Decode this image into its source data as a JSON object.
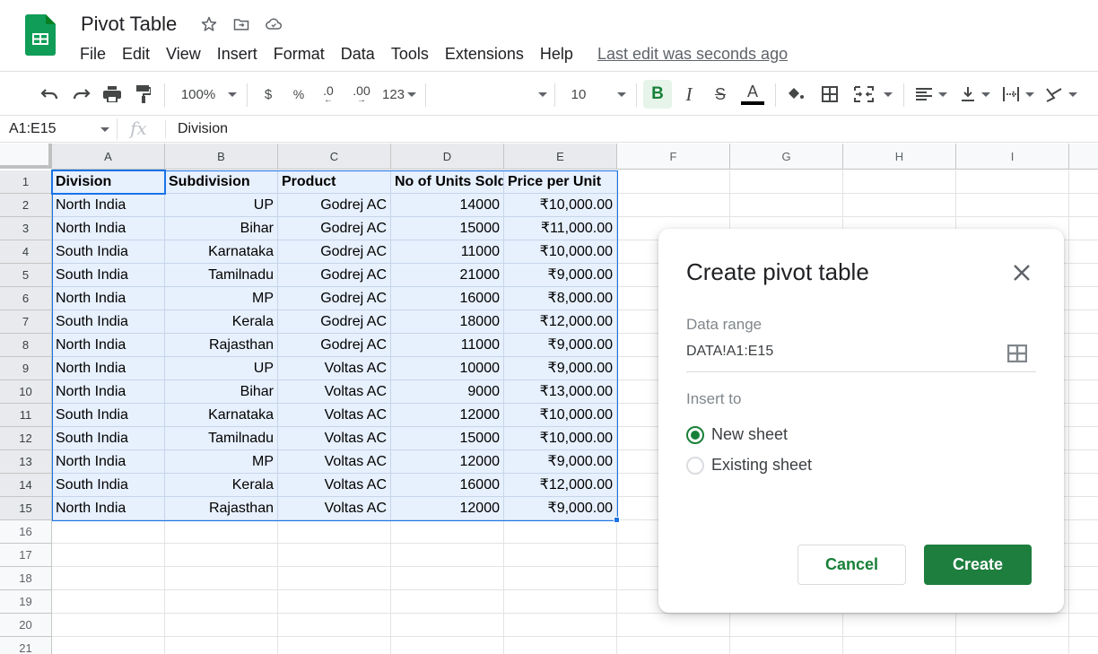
{
  "app": {
    "title": "Pivot Table",
    "brand_color": "#0f9d58",
    "menu": [
      "File",
      "Edit",
      "View",
      "Insert",
      "Format",
      "Data",
      "Tools",
      "Extensions",
      "Help"
    ],
    "last_edit": "Last edit was seconds ago",
    "title_icons": [
      "star-icon",
      "move-to-folder-icon",
      "cloud-saved-icon"
    ]
  },
  "toolbar": {
    "zoom": "100%",
    "currency": "$",
    "percent": "%",
    "decrease_decimal": ".0",
    "increase_decimal": ".00",
    "more_formats": "123",
    "font_family": "",
    "font_size": "10",
    "bold": "B",
    "italic": "I",
    "strikethrough": "S",
    "text_color": "A",
    "accent_color": "#188038"
  },
  "formula_bar": {
    "name_box": "A1:E15",
    "fx": "fx",
    "value": "Division"
  },
  "sheet": {
    "columns": [
      "A",
      "B",
      "C",
      "D",
      "E",
      "F",
      "G",
      "H",
      "I"
    ],
    "row_numbers": [
      "1",
      "2",
      "3",
      "4",
      "5",
      "6",
      "7",
      "8",
      "9",
      "10",
      "11",
      "12",
      "13",
      "14",
      "15",
      "16",
      "17",
      "18",
      "19",
      "20",
      "21"
    ],
    "headers": [
      "Division",
      "Subdivision",
      "Product",
      "No of Units Sold",
      "Price per Unit"
    ],
    "rows": [
      [
        "North India",
        "UP",
        "Godrej AC",
        "14000",
        "₹10,000.00"
      ],
      [
        "North India",
        "Bihar",
        "Godrej AC",
        "15000",
        "₹11,000.00"
      ],
      [
        "South India",
        "Karnataka",
        "Godrej AC",
        "11000",
        "₹10,000.00"
      ],
      [
        "South India",
        "Tamilnadu",
        "Godrej AC",
        "21000",
        "₹9,000.00"
      ],
      [
        "North India",
        "MP",
        "Godrej AC",
        "16000",
        "₹8,000.00"
      ],
      [
        "South India",
        "Kerala",
        "Godrej AC",
        "18000",
        "₹12,000.00"
      ],
      [
        "North India",
        "Rajasthan",
        "Godrej AC",
        "11000",
        "₹9,000.00"
      ],
      [
        "North India",
        "UP",
        "Voltas AC",
        "10000",
        "₹9,000.00"
      ],
      [
        "North India",
        "Bihar",
        "Voltas AC",
        "9000",
        "₹13,000.00"
      ],
      [
        "South India",
        "Karnataka",
        "Voltas AC",
        "12000",
        "₹10,000.00"
      ],
      [
        "South India",
        "Tamilnadu",
        "Voltas AC",
        "15000",
        "₹10,000.00"
      ],
      [
        "North India",
        "MP",
        "Voltas AC",
        "12000",
        "₹9,000.00"
      ],
      [
        "South India",
        "Kerala",
        "Voltas AC",
        "16000",
        "₹12,000.00"
      ],
      [
        "North India",
        "Rajasthan",
        "Voltas AC",
        "12000",
        "₹9,000.00"
      ]
    ],
    "selection_color": "#1a73e8"
  },
  "dialog": {
    "title": "Create pivot table",
    "data_range_label": "Data range",
    "data_range_value": "DATA!A1:E15",
    "insert_to_label": "Insert to",
    "options": [
      {
        "label": "New sheet",
        "selected": true
      },
      {
        "label": "Existing sheet",
        "selected": false
      }
    ],
    "cancel_label": "Cancel",
    "create_label": "Create",
    "primary_color": "#1e7e3e"
  }
}
